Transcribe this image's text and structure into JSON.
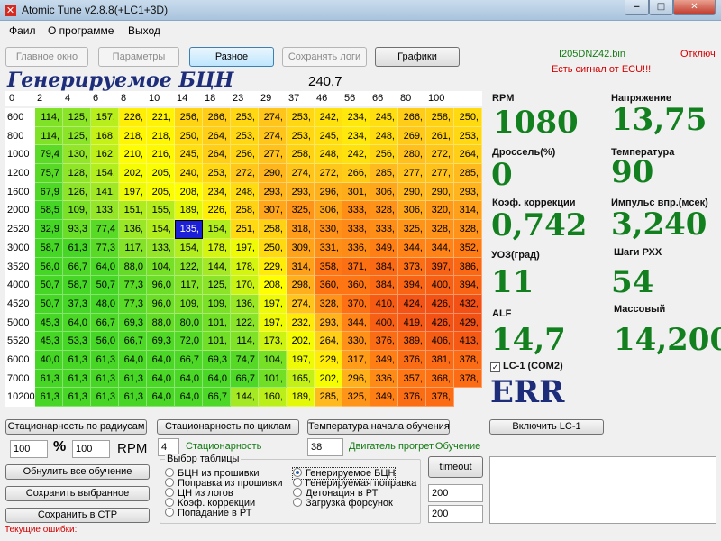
{
  "window": {
    "title": "Atomic Tune  v2.8.8(+LC1+3D)",
    "app_icon": "x-close-red-icon"
  },
  "menu": [
    "Фаил",
    "О программе",
    "Выход"
  ],
  "toolbar": {
    "main_window": "Главное окно",
    "params": "Параметры",
    "misc": "Разное",
    "save_logs": "Сохранять логи",
    "graphs": "Графики"
  },
  "status": {
    "file": "I205DNZ42.bin",
    "connection": "Отключ",
    "ecu_signal": "Есть сигнал от ECU!!!"
  },
  "table": {
    "title": "Генерируемое БЦН",
    "current_value": "240,7",
    "columns": [
      "0",
      "2",
      "4",
      "6",
      "8",
      "10",
      "14",
      "18",
      "23",
      "29",
      "37",
      "46",
      "56",
      "66",
      "80",
      "100"
    ],
    "rows": [
      {
        "rpm": "600",
        "v": [
          "114,",
          "125,",
          "157,",
          "226,",
          "221,",
          "256,",
          "266,",
          "253,",
          "274,",
          "253,",
          "242,",
          "234,",
          "245,",
          "266,",
          "258,",
          "250,"
        ]
      },
      {
        "rpm": "800",
        "v": [
          "114,",
          "125,",
          "168,",
          "218,",
          "218,",
          "250,",
          "264,",
          "253,",
          "274,",
          "253,",
          "245,",
          "234,",
          "248,",
          "269,",
          "261,",
          "253,"
        ]
      },
      {
        "rpm": "1000",
        "v": [
          "79,4",
          "130,",
          "162,",
          "210,",
          "216,",
          "245,",
          "264,",
          "256,",
          "277,",
          "258,",
          "248,",
          "242,",
          "256,",
          "280,",
          "272,",
          "264,"
        ]
      },
      {
        "rpm": "1200",
        "v": [
          "75,7",
          "128,",
          "154,",
          "202,",
          "205,",
          "240,",
          "253,",
          "272,",
          "290,",
          "274,",
          "272,",
          "266,",
          "285,",
          "277,",
          "277,",
          "285,"
        ]
      },
      {
        "rpm": "1600",
        "v": [
          "67,9",
          "126,",
          "141,",
          "197,",
          "205,",
          "208,",
          "234,",
          "248,",
          "293,",
          "293,",
          "296,",
          "301,",
          "306,",
          "290,",
          "290,",
          "293,"
        ]
      },
      {
        "rpm": "2000",
        "v": [
          "58,5",
          "109,",
          "133,",
          "151,",
          "155,",
          "189,",
          "226,",
          "258,",
          "307,",
          "325,",
          "306,",
          "333,",
          "328,",
          "306,",
          "320,",
          "314,"
        ]
      },
      {
        "rpm": "2520",
        "v": [
          "32,9",
          "93,3",
          "77,4",
          "136,",
          "154,",
          "135,",
          "154,",
          "251,",
          "258,",
          "318,",
          "330,",
          "338,",
          "333,",
          "325,",
          "328,",
          "328,"
        ]
      },
      {
        "rpm": "3000",
        "v": [
          "58,7",
          "61,3",
          "77,3",
          "117,",
          "133,",
          "154,",
          "178,",
          "197,",
          "250,",
          "309,",
          "331,",
          "336,",
          "349,",
          "344,",
          "344,",
          "352,"
        ]
      },
      {
        "rpm": "3520",
        "v": [
          "56,0",
          "66,7",
          "64,0",
          "88,0",
          "104,",
          "122,",
          "144,",
          "178,",
          "229,",
          "314,",
          "358,",
          "371,",
          "384,",
          "373,",
          "397,",
          "386,"
        ]
      },
      {
        "rpm": "4000",
        "v": [
          "50,7",
          "58,7",
          "50,7",
          "77,3",
          "96,0",
          "117,",
          "125,",
          "170,",
          "208,",
          "298,",
          "360,",
          "360,",
          "384,",
          "394,",
          "400,",
          "394,"
        ]
      },
      {
        "rpm": "4520",
        "v": [
          "50,7",
          "37,3",
          "48,0",
          "77,3",
          "96,0",
          "109,",
          "109,",
          "136,",
          "197,",
          "274,",
          "328,",
          "370,",
          "410,",
          "424,",
          "426,",
          "432,"
        ]
      },
      {
        "rpm": "5000",
        "v": [
          "45,3",
          "64,0",
          "66,7",
          "69,3",
          "88,0",
          "80,0",
          "101,",
          "122,",
          "197,",
          "232,",
          "293,",
          "344,",
          "400,",
          "419,",
          "426,",
          "429,"
        ]
      },
      {
        "rpm": "5520",
        "v": [
          "45,3",
          "53,3",
          "56,0",
          "66,7",
          "69,3",
          "72,0",
          "101,",
          "114,",
          "173,",
          "202,",
          "264,",
          "330,",
          "376,",
          "389,",
          "406,",
          "413,"
        ]
      },
      {
        "rpm": "6000",
        "v": [
          "40,0",
          "61,3",
          "61,3",
          "64,0",
          "64,0",
          "66,7",
          "69,3",
          "74,7",
          "104,",
          "197,",
          "229,",
          "317,",
          "349,",
          "376,",
          "381,",
          "378,"
        ]
      },
      {
        "rpm": "7000",
        "v": [
          "61,3",
          "61,3",
          "61,3",
          "61,3",
          "64,0",
          "64,0",
          "64,0",
          "66,7",
          "101,",
          "165,",
          "202,",
          "296,",
          "336,",
          "357,",
          "368,",
          "378,"
        ]
      },
      {
        "rpm": "10200",
        "v": [
          "61,3",
          "61,3",
          "61,3",
          "61,3",
          "64,0",
          "64,0",
          "66,7",
          "144,",
          "160,",
          "189,",
          "285,",
          "325,",
          "349,",
          "376,",
          "378,"
        ]
      }
    ]
  },
  "gauges": {
    "rpm": {
      "label": "RPM",
      "value": "1080"
    },
    "voltage": {
      "label": "Напряжение",
      "value": "13,75"
    },
    "throttle": {
      "label": "Дроссель(%)",
      "value": "0"
    },
    "temp": {
      "label": "Температура",
      "value": "90"
    },
    "corr": {
      "label": "Коэф. коррекции",
      "value": "0,742"
    },
    "inj": {
      "label": "Импульс впр.(мсек)",
      "value": "3,240"
    },
    "uoz": {
      "label": "УОЗ(град)",
      "value": "11"
    },
    "rxx": {
      "label": "Шаги РХХ",
      "value": "54"
    },
    "alf": {
      "label": "ALF",
      "value": "14,7"
    },
    "mass": {
      "label": "Массовый",
      "value": "14,200"
    },
    "lc1": {
      "label": "LC-1 (COM2)",
      "value": "ERR"
    }
  },
  "controls": {
    "stat_radius": "Стационарность по радиусам",
    "stat_cycles": "Стационарность по циклам",
    "learn_temp": "Температура начала обучения",
    "enable_lc1": "Включить LC-1",
    "percent_value": "100",
    "percent_unit": "%",
    "rpm_value": "100",
    "rpm_unit": "RPM",
    "stationarity_value": "4",
    "stationarity_label": "Стационарность",
    "engine_temp_value": "38",
    "engine_warm_label": "Двигатель прогрет.Обучение",
    "reset_learning": "Обнулить все обучение",
    "save_selected": "Сохранить выбранное",
    "save_ctp": "Сохранить в СТР",
    "errors_label": "Текущие ошибки:",
    "timeout": "timeout",
    "val1": "200",
    "val2": "200"
  },
  "table_select": {
    "title": "Выбор таблицы",
    "options": [
      "БЦН из прошивки",
      "Поправка из прошивки",
      "ЦН из логов",
      "Коэф. коррекции",
      "Попадание в РТ",
      "Генерируемое БЦН",
      "Генерируемая поправка",
      "Детонация в РТ",
      "Загрузка форсунок"
    ],
    "selected": "Генерируемое БЦН"
  }
}
